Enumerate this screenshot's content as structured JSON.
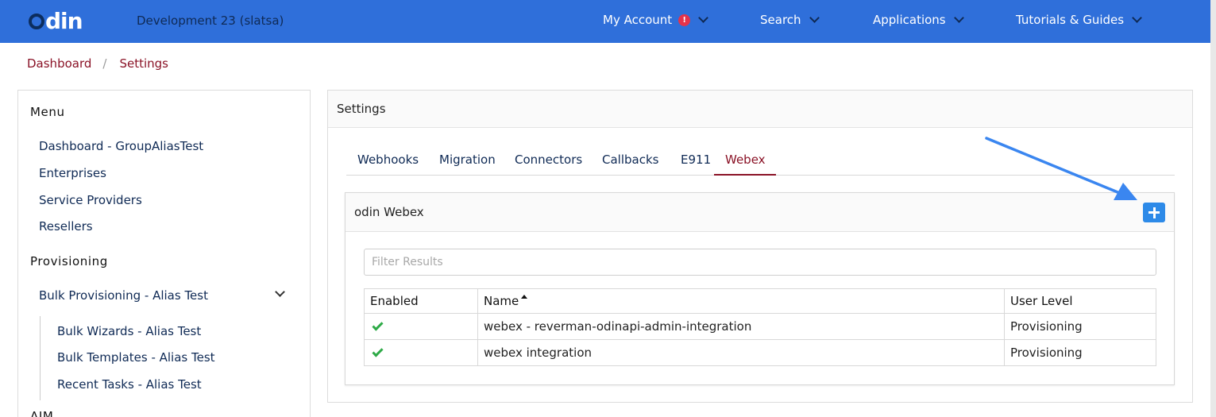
{
  "topbar": {
    "logo_text": "din",
    "environment": "Development 23 (slatsa)",
    "nav": [
      {
        "label": "My Account",
        "badge": "!"
      },
      {
        "label": "Search"
      },
      {
        "label": "Applications"
      },
      {
        "label": "Tutorials & Guides"
      }
    ]
  },
  "breadcrumb": [
    "Dashboard",
    "Settings"
  ],
  "sidebar": {
    "menu_heading": "Menu",
    "menu_items": [
      "Dashboard - GroupAliasTest",
      "Enterprises",
      "Service Providers",
      "Resellers"
    ],
    "provisioning_heading": "Provisioning",
    "provisioning_group": "Bulk Provisioning - Alias Test",
    "provisioning_items": [
      "Bulk Wizards - Alias Test",
      "Bulk Templates - Alias Test",
      "Recent Tasks - Alias Test"
    ],
    "next_heading": "AIM"
  },
  "settings": {
    "title": "Settings",
    "tabs": [
      "Webhooks",
      "Migration",
      "Connectors",
      "Callbacks",
      "E911",
      "Webex"
    ],
    "active_tab": "Webex",
    "card_title": "odin Webex",
    "filter_placeholder": "Filter Results",
    "table": {
      "headers": [
        "Enabled",
        "Name",
        "User Level"
      ],
      "sorted_column": "Name",
      "rows": [
        {
          "enabled": true,
          "name": "webex - reverman-odinapi-admin-integration",
          "user_level": "Provisioning"
        },
        {
          "enabled": true,
          "name": "webex integration",
          "user_level": "Provisioning"
        }
      ]
    }
  },
  "colors": {
    "topbar": "#2f6fda",
    "link_dark": "#0f2a55",
    "breadcrumb_and_active_tab": "#8a1226",
    "add_button": "#2d8ae8",
    "check": "#2eaa47",
    "badge": "#e5334b"
  }
}
